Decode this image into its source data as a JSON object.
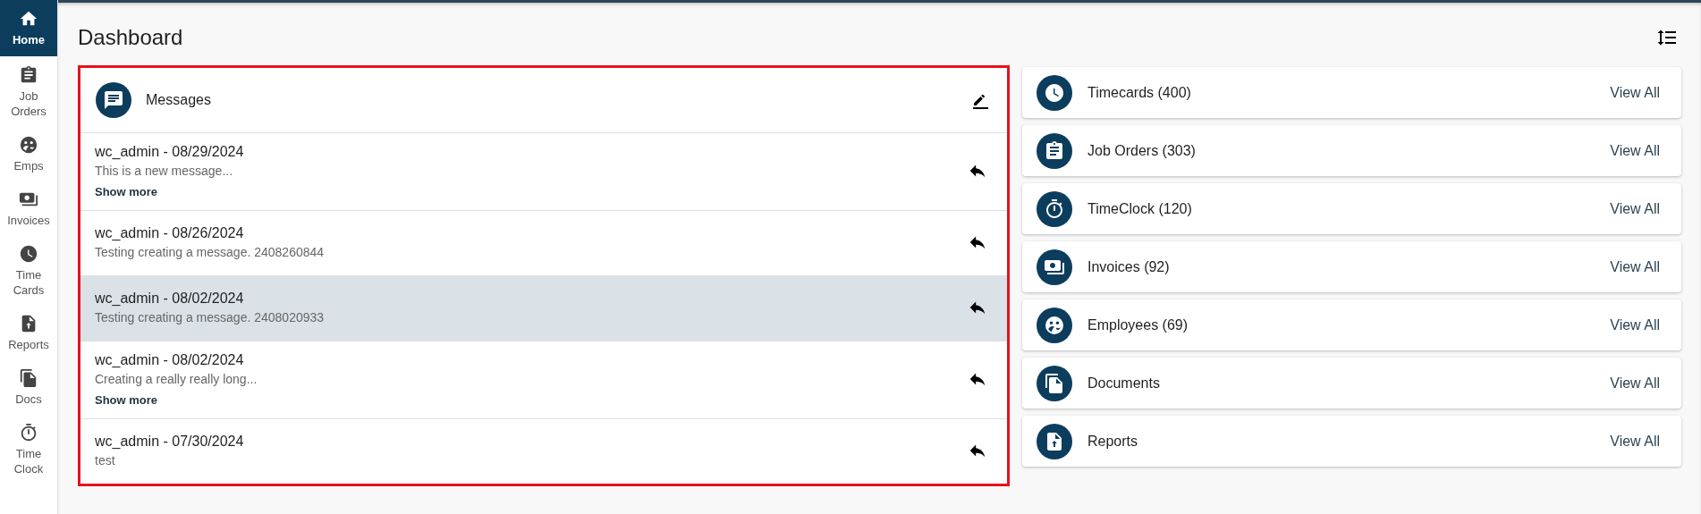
{
  "sidebar": {
    "items": [
      {
        "label": "Home",
        "selected": true
      },
      {
        "label": "Job Orders",
        "selected": false
      },
      {
        "label": "Emps",
        "selected": false
      },
      {
        "label": "Invoices",
        "selected": false
      },
      {
        "label": "Time Cards",
        "selected": false
      },
      {
        "label": "Reports",
        "selected": false
      },
      {
        "label": "Docs",
        "selected": false
      },
      {
        "label": "Time Clock",
        "selected": false
      }
    ]
  },
  "page": {
    "title": "Dashboard"
  },
  "messages": {
    "title": "Messages",
    "items": [
      {
        "heading": "wc_admin - 08/29/2024",
        "body": "This is a new message...",
        "show_more": "Show more",
        "selected": false
      },
      {
        "heading": "wc_admin - 08/26/2024",
        "body": "Testing creating a message. 2408260844",
        "selected": false
      },
      {
        "heading": "wc_admin - 08/02/2024",
        "body": "Testing creating a message. 2408020933",
        "selected": true
      },
      {
        "heading": "wc_admin - 08/02/2024",
        "body": "Creating a really really long...",
        "show_more": "Show more",
        "selected": false
      },
      {
        "heading": "wc_admin - 07/30/2024",
        "body": "test",
        "selected": false
      }
    ]
  },
  "summary_cards": [
    {
      "label": "Timecards (400)",
      "action": "View All"
    },
    {
      "label": "Job Orders (303)",
      "action": "View All"
    },
    {
      "label": "TimeClock (120)",
      "action": "View All"
    },
    {
      "label": "Invoices (92)",
      "action": "View All"
    },
    {
      "label": "Employees (69)",
      "action": "View All"
    },
    {
      "label": "Documents",
      "action": "View All"
    },
    {
      "label": "Reports",
      "action": "View All"
    }
  ]
}
